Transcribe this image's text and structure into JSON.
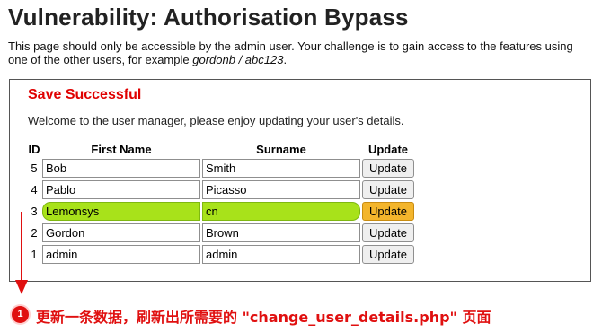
{
  "page": {
    "title": "Vulnerability: Authorisation Bypass",
    "intro_text": "This page should only be accessible by the admin user. Your challenge is to gain access to the features using one of the other users, for example",
    "example_credentials": "gordonb / abc123",
    "intro_end": "."
  },
  "panel": {
    "status": "Save Successful",
    "welcome": "Welcome to the user manager, please enjoy updating your user's details.",
    "headers": {
      "id": "ID",
      "first_name": "First Name",
      "surname": "Surname",
      "update": "Update"
    },
    "rows": [
      {
        "id": "5",
        "first_name": "Bob",
        "surname": "Smith",
        "button": "Update"
      },
      {
        "id": "4",
        "first_name": "Pablo",
        "surname": "Picasso",
        "button": "Update"
      },
      {
        "id": "3",
        "first_name": "Lemonsys",
        "surname": "cn",
        "button": "Update"
      },
      {
        "id": "2",
        "first_name": "Gordon",
        "surname": "Brown",
        "button": "Update"
      },
      {
        "id": "1",
        "first_name": "admin",
        "surname": "admin",
        "button": "Update"
      }
    ]
  },
  "annotation": {
    "badge": "1",
    "text": "更新一条数据，刷新出所需要的 \"change_user_details.php\" 页面",
    "color": "#e01010",
    "highlight_field_color": "#a8e21a",
    "highlight_button_color": "#f3b52c"
  }
}
